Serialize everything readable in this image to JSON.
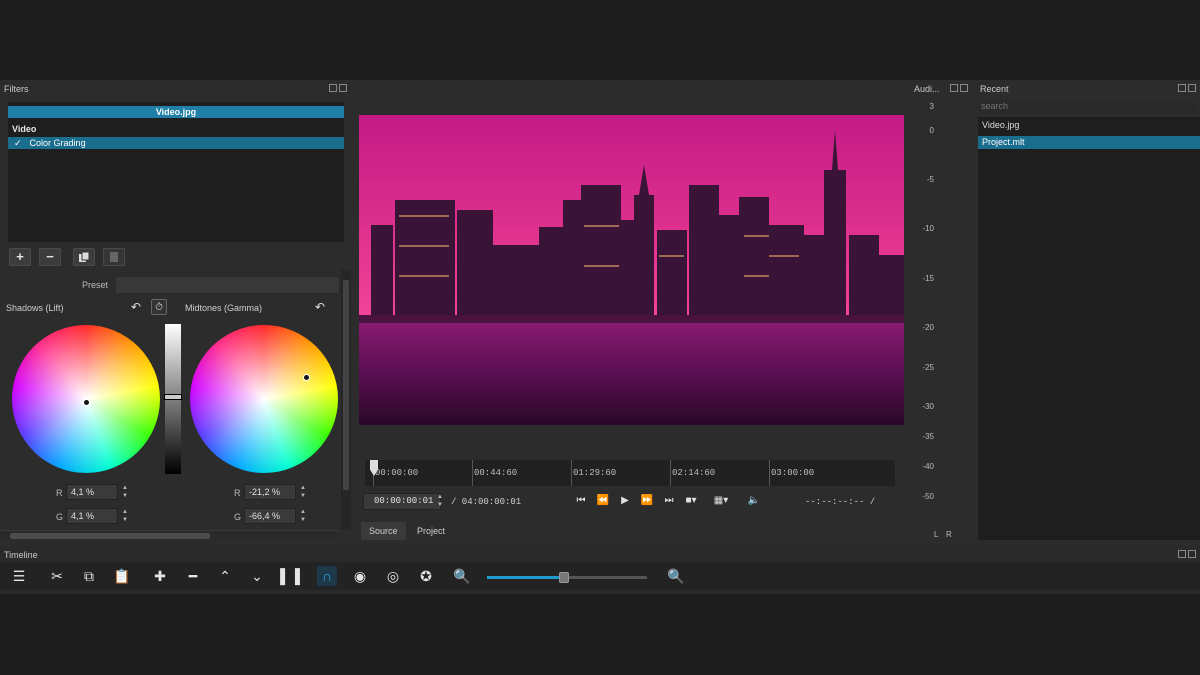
{
  "panels": {
    "filters_title": "Filters",
    "audio_title": "Audi...",
    "recent_title": "Recent",
    "timeline_title": "Timeline"
  },
  "filters": {
    "clip_name": "Video.jpg",
    "section_video": "Video",
    "items": [
      {
        "label": "Color Grading",
        "checked": true
      }
    ],
    "toolbar": {
      "add": "+",
      "remove": "−",
      "copy": "copy-icon",
      "paste": "paste-icon"
    },
    "preset_label": "Preset",
    "shadows": {
      "label": "Shadows (Lift)",
      "r_label": "R",
      "r_value": "4,1 %",
      "g_label": "G",
      "g_value": "4,1 %"
    },
    "midtones": {
      "label": "Midtones (Gamma)",
      "r_label": "R",
      "r_value": "-21,2 %",
      "g_label": "G",
      "g_value": "-66,4 %"
    }
  },
  "player": {
    "ruler_ticks": [
      "00:00:00",
      "00:44:60",
      "01:29:60",
      "02:14:60",
      "03:00:00"
    ],
    "timecode": "00:00:00:01",
    "duration": "/ 04:00:00:01",
    "in_out": "--:--:--:-- /",
    "tabs": [
      "Source",
      "Project"
    ],
    "active_tab": 0
  },
  "audio": {
    "db_scale": [
      "3",
      "0",
      "-5",
      "-10",
      "-15",
      "-20",
      "-25",
      "-30",
      "-35",
      "-40",
      "-50"
    ],
    "left_label": "L",
    "right_label": "R"
  },
  "recent": {
    "search_placeholder": "search",
    "items": [
      "Video.jpg",
      "Project.mlt"
    ],
    "selected_index": 1
  },
  "timeline": {
    "zoom_level": 0.48
  },
  "colors": {
    "accent": "#1f9ad0",
    "selection": "#1b6d8e",
    "panel_bg": "#2c2c2c"
  }
}
